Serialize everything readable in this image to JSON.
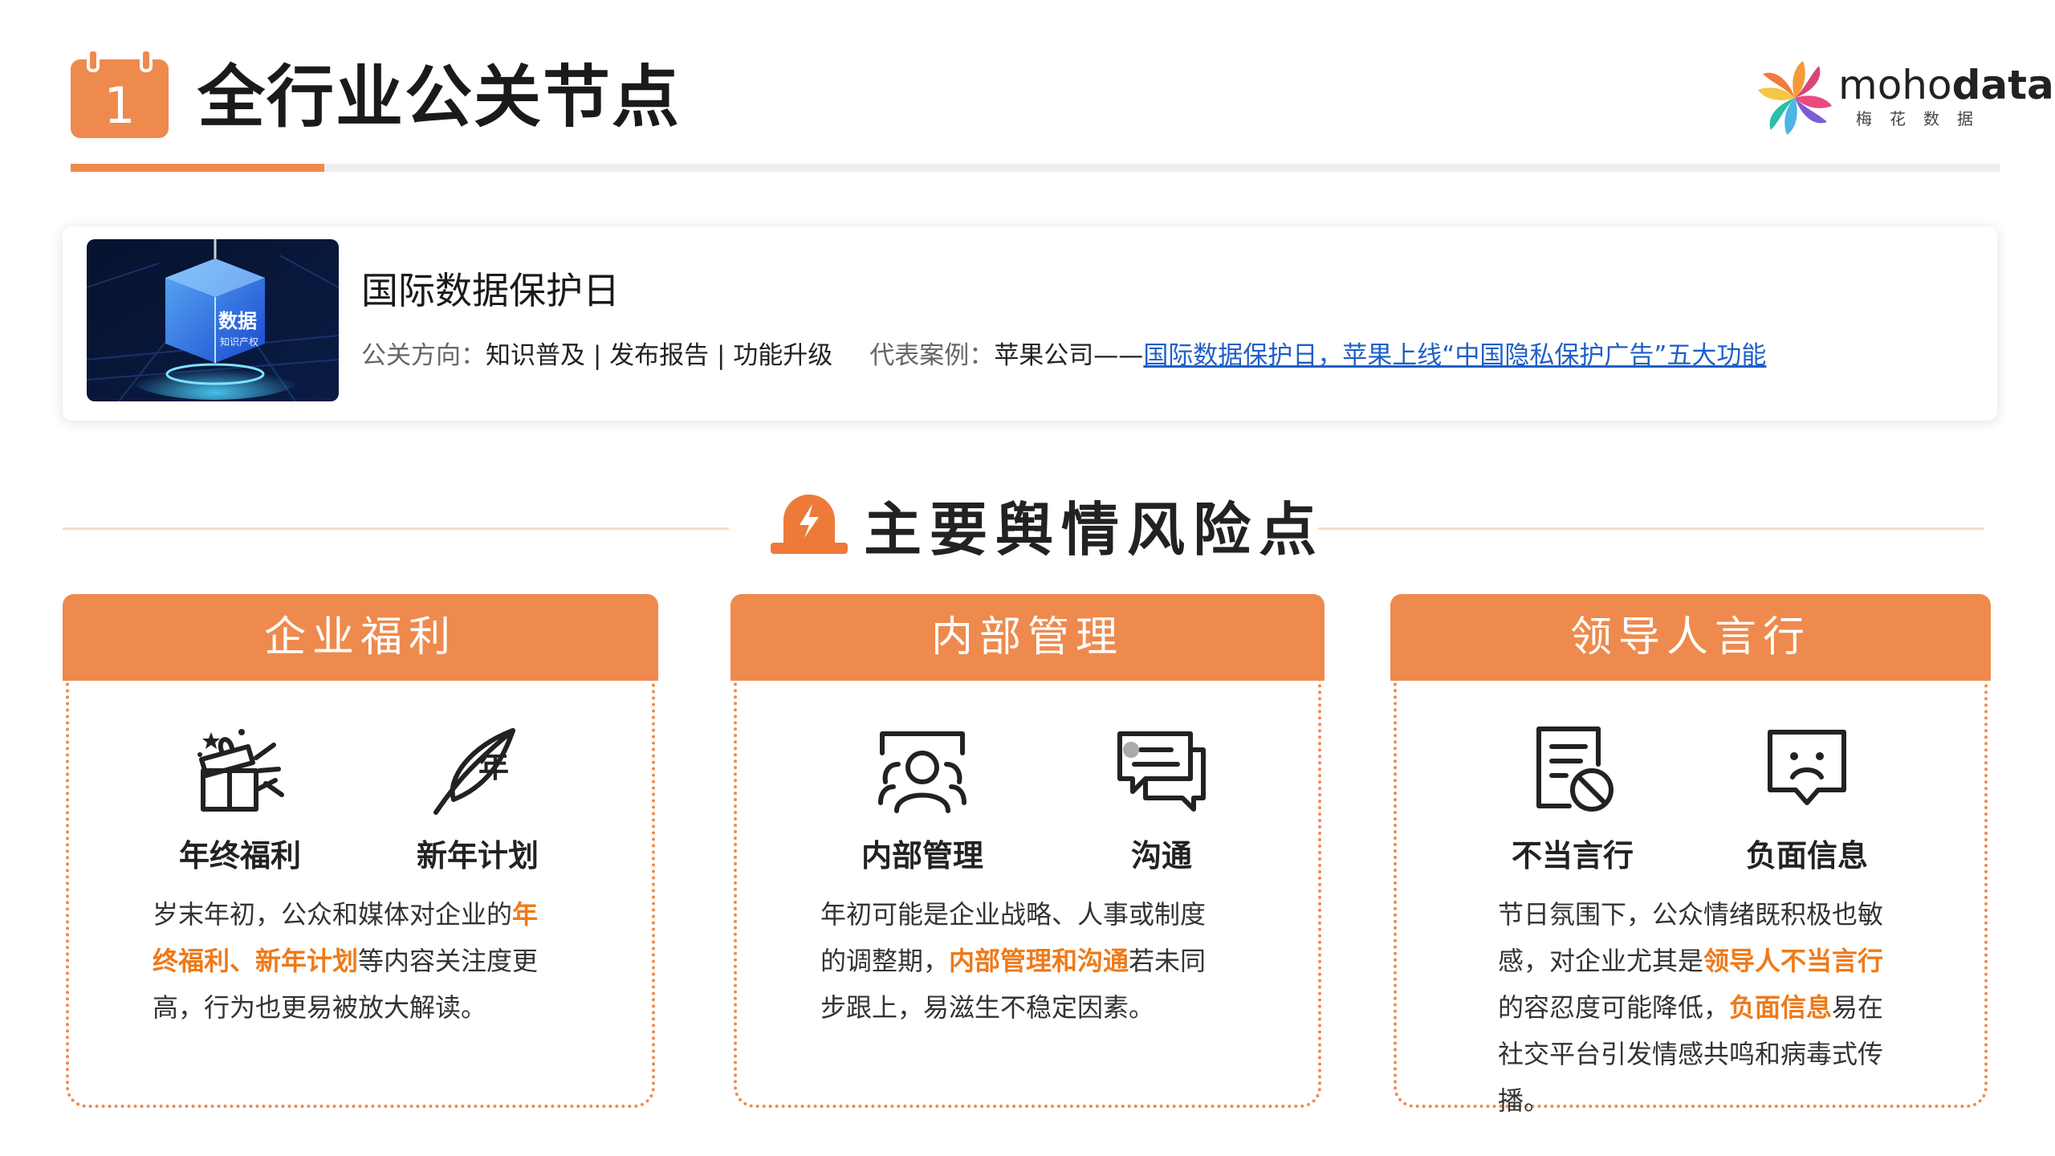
{
  "header": {
    "number": "1",
    "title": "全行业公关节点",
    "logo": {
      "word_light": "moho",
      "word_bold": "data",
      "sub": "梅花数据"
    }
  },
  "event": {
    "name": "国际数据保护日",
    "direction_label": "公关方向：",
    "direction_value": "知识普及 | 发布报告 | 功能升级",
    "case_label": "代表案例：",
    "case_company": "苹果公司——",
    "case_link": "国际数据保护日，苹果上线“中国隐私保护广告”五大功能",
    "image_text_main": "数据",
    "image_text_sub": "知识产权"
  },
  "risk": {
    "title": "主要舆情风险点"
  },
  "panels": [
    {
      "title": "企业福利",
      "items": [
        {
          "label": "年终福利",
          "icon": "gift-box-icon"
        },
        {
          "label": "新年计划",
          "icon": "feather-pen-icon",
          "glyph": "年"
        }
      ],
      "desc": [
        {
          "t": "岁末年初，公众和媒体对企业的",
          "hl": false
        },
        {
          "t": "年终福利、新年计划",
          "hl": true
        },
        {
          "t": "等内容关注度更高，行为也更易被放大解读。",
          "hl": false
        }
      ]
    },
    {
      "title": "内部管理",
      "items": [
        {
          "label": "内部管理",
          "icon": "team-icon"
        },
        {
          "label": "沟通",
          "icon": "chat-bubbles-icon"
        }
      ],
      "desc": [
        {
          "t": "年初可能是企业战略、人事或制度的调整期，",
          "hl": false
        },
        {
          "t": "内部管理和沟通",
          "hl": true
        },
        {
          "t": "若未同步跟上，易滋生不稳定因素。",
          "hl": false
        }
      ]
    },
    {
      "title": "领导人言行",
      "items": [
        {
          "label": "不当言行",
          "icon": "forbidden-document-icon"
        },
        {
          "label": "负面信息",
          "icon": "sad-message-icon"
        }
      ],
      "desc": [
        {
          "t": "节日氛围下，公众情绪既积极也敏感，对企业尤其是",
          "hl": false
        },
        {
          "t": "领导人不当言行",
          "hl": true
        },
        {
          "t": "的容忍度可能降低，",
          "hl": false
        },
        {
          "t": "负面信息",
          "hl": true
        },
        {
          "t": "易在社交平台引发情感共鸣和病毒式传播。",
          "hl": false
        }
      ]
    }
  ],
  "colors": {
    "accent": "#ee8a4d",
    "highlight": "#ee7a1a",
    "link": "#1f5fc8"
  }
}
